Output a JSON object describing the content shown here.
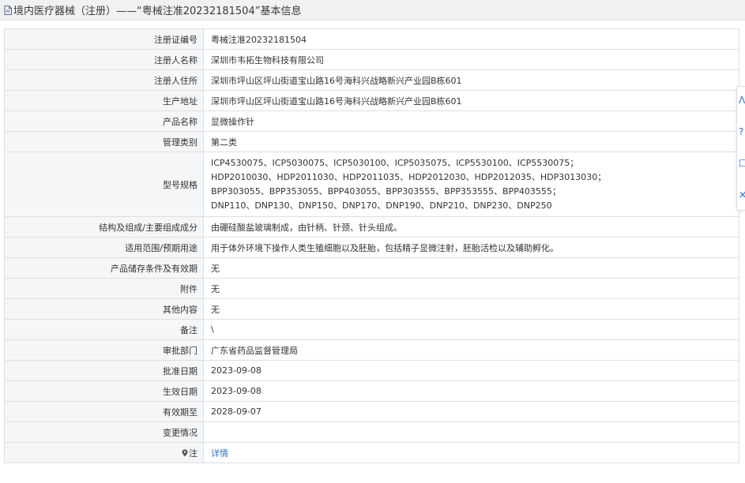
{
  "header": {
    "title": "境内医疗器械（注册）——“粤械注准20232181504”基本信息"
  },
  "rows": [
    {
      "label": "注册证编号",
      "value": "粤械注准20232181504"
    },
    {
      "label": "注册人名称",
      "value": "深圳市韦拓生物科技有限公司"
    },
    {
      "label": "注册人住所",
      "value": "深圳市坪山区坪山街道宝山路16号海科兴战略新兴产业园B栋601"
    },
    {
      "label": "生产地址",
      "value": "深圳市坪山区坪山街道宝山路16号海科兴战略新兴产业园B栋601"
    },
    {
      "label": "产品名称",
      "value": "显微操作针"
    },
    {
      "label": "管理类别",
      "value": "第二类"
    }
  ],
  "model_spec": {
    "label": "型号规格",
    "lines": [
      "ICP4530075、ICP5030075、ICP5030100、ICP5035075、ICP5530100、ICP5530075；",
      "HDP2010030、HDP2011030、HDP2011035、HDP2012030、HDP2012035、HDP3013030；",
      "BPP303055、BPP353055、BPP403055、BPP303555、BPP353555、BPP403555；",
      "DNP110、DNP130、DNP150、DNP170、DNP190、DNP210、DNP230、DNP250"
    ]
  },
  "rows2": [
    {
      "label": "结构及组成/主要组成成分",
      "value": "由硼硅酸盐玻璃制成，由针柄、针颈、针头组成。"
    },
    {
      "label": "适用范围/预期用途",
      "value": "用于体外环境下操作人类生殖细胞以及胚胎，包括精子显微注射，胚胎活检以及辅助孵化。"
    },
    {
      "label": "产品储存条件及有效期",
      "value": "无"
    },
    {
      "label": "附件",
      "value": "无"
    },
    {
      "label": "其他内容",
      "value": "无"
    },
    {
      "label": "备注",
      "value": "\\"
    },
    {
      "label": "审批部门",
      "value": "广东省药品监督管理局"
    },
    {
      "label": "批准日期",
      "value": "2023-09-08"
    },
    {
      "label": "生效日期",
      "value": "2023-09-08"
    },
    {
      "label": "有效期至",
      "value": "2028-09-07"
    },
    {
      "label": "变更情况",
      "value": ""
    }
  ],
  "note_row": {
    "label": "注",
    "link_text": "详情"
  },
  "side_tools": [
    "ᐱ",
    "?",
    "☐",
    "✕"
  ],
  "colors": {
    "link": "#2a73c9",
    "label_bg": "#f5f6f8",
    "border": "#dcdfe3"
  }
}
